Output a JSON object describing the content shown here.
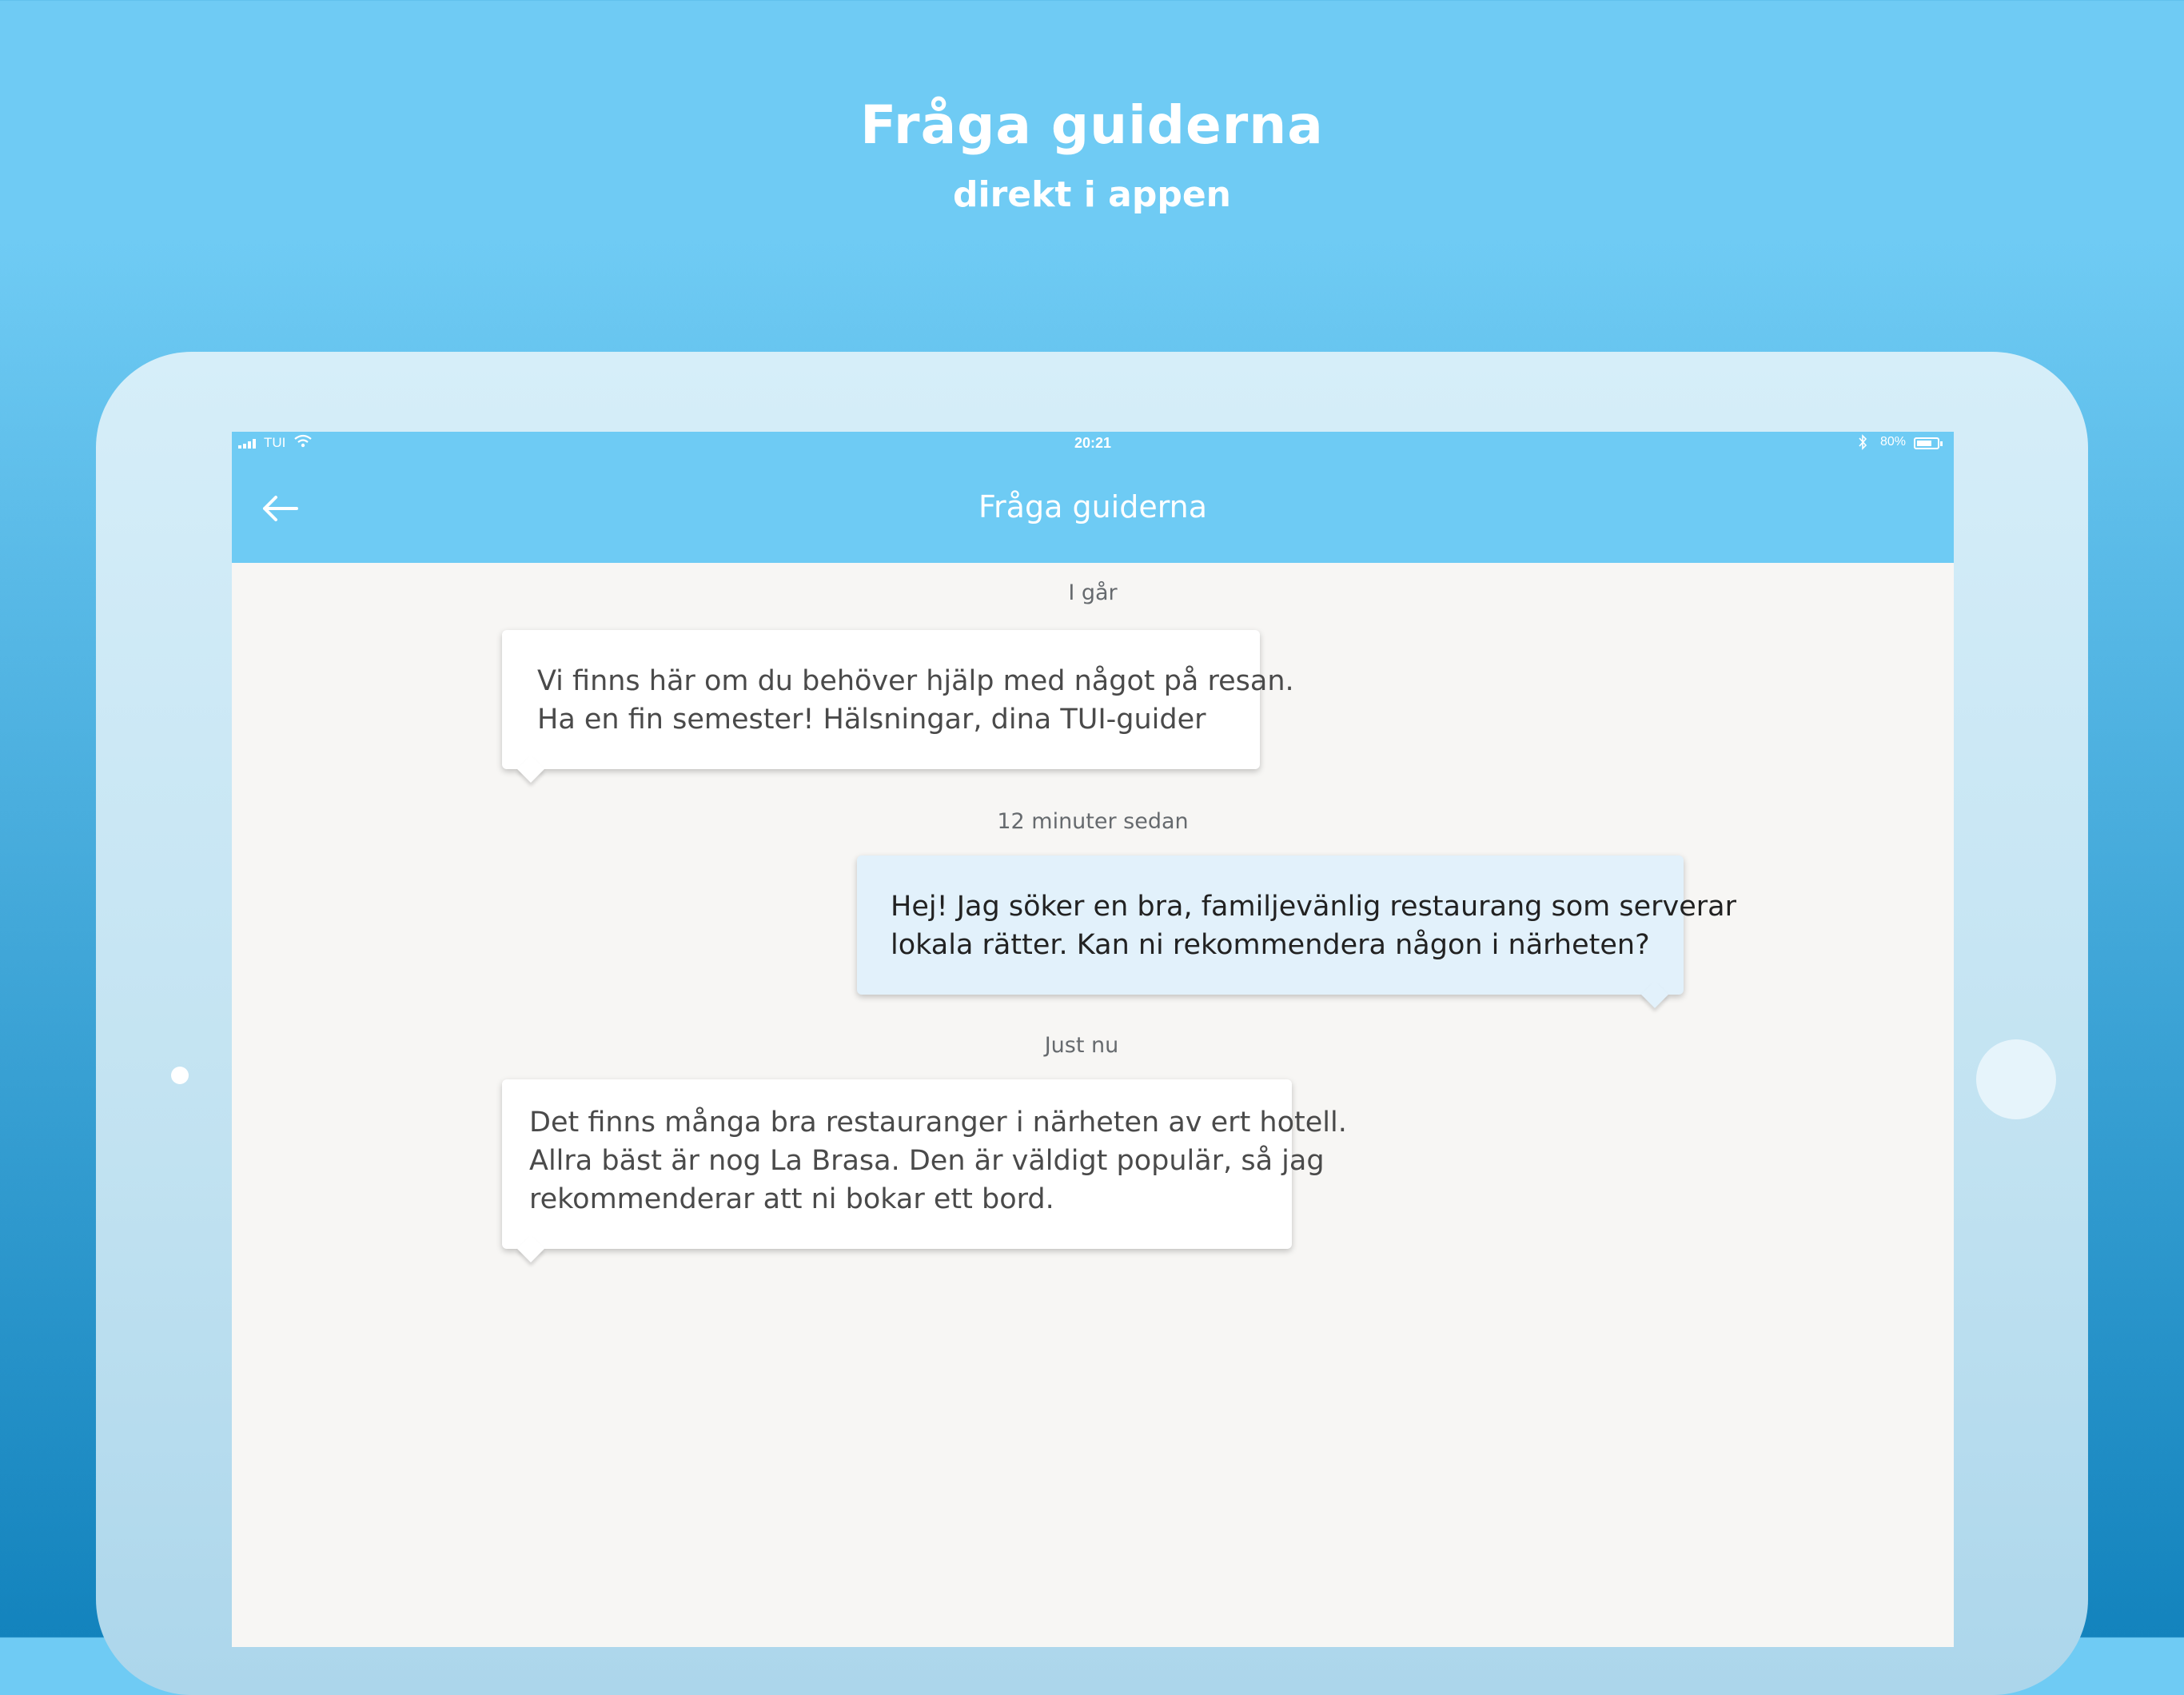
{
  "promo": {
    "title": "Fråga guiderna",
    "subtitle": "direkt i appen"
  },
  "status_bar": {
    "carrier": "TUI",
    "time": "20:21",
    "battery": "80%",
    "battery_level": 0.8
  },
  "nav": {
    "title": "Fråga guiderna",
    "back_icon": "arrow-left-icon"
  },
  "conversation": [
    {
      "day_label": "I går",
      "direction": "incoming",
      "lines": [
        "Vi finns här om du behöver hjälp med något på resan.",
        "Ha en fin semester! Hälsningar, dina TUI-guider"
      ]
    },
    {
      "day_label": "12 minuter sedan",
      "direction": "outgoing",
      "lines": [
        "Hej! Jag söker en bra, familjevänlig restaurang som serverar",
        "lokala rätter. Kan ni rekommendera någon i närheten?"
      ]
    },
    {
      "day_label": "Just nu",
      "direction": "incoming",
      "lines": [
        "Det finns många bra restauranger i närheten av ert hotell.",
        "Allra bäst är nog La Brasa. Den är väldigt populär, så jag",
        "rekommenderar att ni bokar ett bord."
      ]
    }
  ],
  "colors": {
    "accent": "#6ecbf4",
    "screen_background": "#f7f6f4",
    "outgoing_bubble": "#e2f1fb",
    "incoming_bubble": "#ffffff"
  }
}
